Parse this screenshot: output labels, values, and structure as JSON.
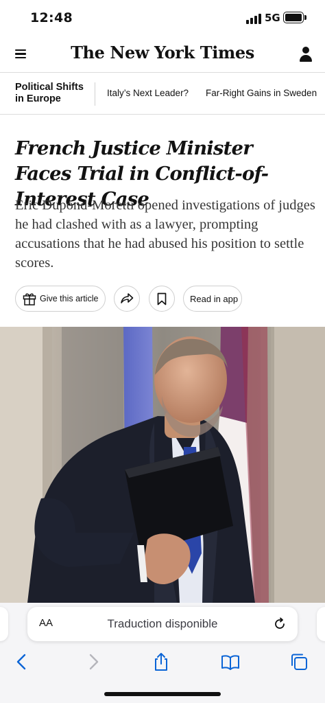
{
  "status_bar": {
    "time": "12:48",
    "network": "5G",
    "battery_level": 1.0
  },
  "header": {
    "masthead": "The New York Times",
    "menu_icon": "hamburger-menu-icon",
    "account_icon": "account-icon"
  },
  "section_nav": {
    "title": "Political Shifts in Europe",
    "links": [
      "Italy’s Next Leader?",
      "Far-Right Gains in Sweden"
    ]
  },
  "article": {
    "headline": "French Justice Minister Faces Trial in Conflict-of-Interest Case",
    "summary": "Éric Dupond-Moretti opened investigations of judges he had clashed with as a lawyer, prompting accusations that he had abused his position to settle scores."
  },
  "actions": {
    "give_label": "Give this article",
    "give_icon": "gift-icon",
    "share_icon": "share-arrow-icon",
    "save_icon": "bookmark-icon",
    "read_in_app_label": "Read in app"
  },
  "safari": {
    "aa_label": "AA",
    "translation_text": "Traduction disponible",
    "reload_icon": "reload-icon",
    "toolbar_icons": [
      "back-icon",
      "forward-icon",
      "share-icon",
      "bookmarks-icon",
      "tabs-icon"
    ]
  },
  "colors": {
    "text": "#121212",
    "safari_blue": "#0a64d6",
    "disabled_gray": "#b5b5bb"
  }
}
